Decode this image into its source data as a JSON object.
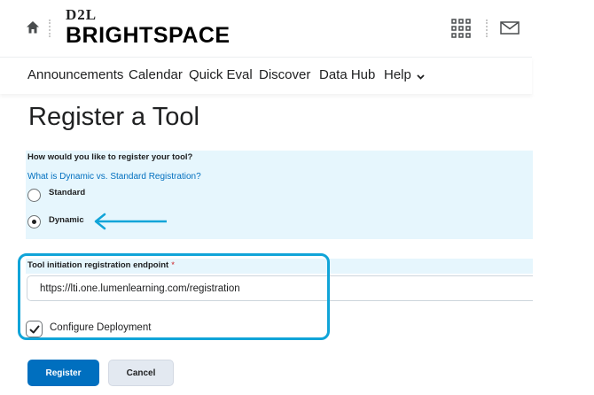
{
  "header": {
    "logo_top": "D2L",
    "logo_bottom": "BRIGHTSPACE",
    "icons": [
      "home-icon",
      "waffle-grid-icon",
      "mail-icon"
    ]
  },
  "nav": {
    "items": [
      "Announcements",
      "Calendar",
      "Quick Eval",
      "Discover",
      "Data Hub",
      "Help"
    ]
  },
  "page": {
    "title": "Register a Tool"
  },
  "registration": {
    "question": "How would you like to register your tool?",
    "help_link": "What is Dynamic vs. Standard Registration?",
    "options": [
      {
        "label": "Standard",
        "selected": false
      },
      {
        "label": "Dynamic",
        "selected": true
      }
    ]
  },
  "endpoint": {
    "label": "Tool initiation registration endpoint",
    "required_marker": "*",
    "value": "https://lti.one.lumenlearning.com/registration"
  },
  "deployment": {
    "label": "Configure Deployment",
    "checked": true
  },
  "buttons": {
    "register": "Register",
    "cancel": "Cancel"
  },
  "colors": {
    "accent": "#006fbf",
    "annotation": "#10a4d8",
    "panel_bg": "#e6f6fd"
  }
}
